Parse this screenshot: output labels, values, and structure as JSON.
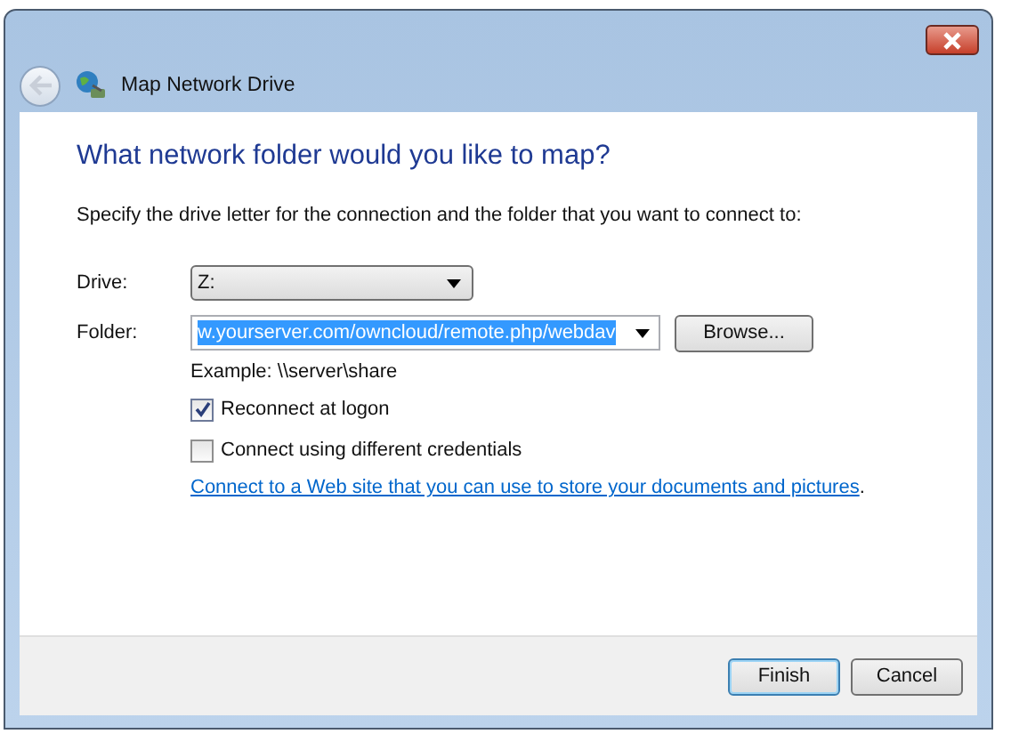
{
  "window": {
    "title": "Map Network Drive"
  },
  "heading": "What network folder would you like to map?",
  "description": "Specify the drive letter for the connection and the folder that you want to connect to:",
  "drive": {
    "label": "Drive:",
    "value": "Z:"
  },
  "folder": {
    "label": "Folder:",
    "value": "w.yourserver.com/owncloud/remote.php/webdav",
    "selected": true
  },
  "browse_button": "Browse...",
  "example": "Example: \\\\server\\share",
  "options": [
    {
      "label": "Reconnect at logon",
      "checked": true
    },
    {
      "label": "Connect using different credentials",
      "checked": false
    }
  ],
  "link": {
    "text": "Connect to a Web site that you can use to store your documents and pictures",
    "suffix": "."
  },
  "buttons": [
    {
      "label": "Finish",
      "default": true
    },
    {
      "label": "Cancel",
      "default": false
    }
  ]
}
